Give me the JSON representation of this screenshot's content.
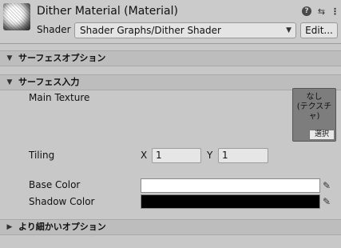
{
  "header": {
    "title": "Dither Material (Material)",
    "help_icon": "?",
    "preset_icon": "⇆",
    "menu_icon": "⋮",
    "shader_label": "Shader",
    "shader_value": "Shader Graphs/Dither Shader",
    "dropdown_arrow": "▼",
    "edit_label": "Edit..."
  },
  "sections": {
    "surface_options": {
      "arrow": "▼",
      "title": "サーフェスオプション"
    },
    "surface_inputs": {
      "arrow": "▼",
      "title": "サーフェス入力"
    },
    "advanced_options": {
      "arrow": "▶",
      "title": "より細かいオプション"
    }
  },
  "main_texture": {
    "label": "Main Texture",
    "none_text": "なし",
    "type_text": "(テクスチャ)",
    "select_label": "選択"
  },
  "tiling": {
    "label": "Tiling",
    "x_label": "X",
    "x_value": "1",
    "y_label": "Y",
    "y_value": "1"
  },
  "base_color": {
    "label": "Base Color",
    "color": "#ffffff"
  },
  "shadow_color": {
    "label": "Shadow Color",
    "color": "#000000"
  },
  "picker_icon": "✎"
}
